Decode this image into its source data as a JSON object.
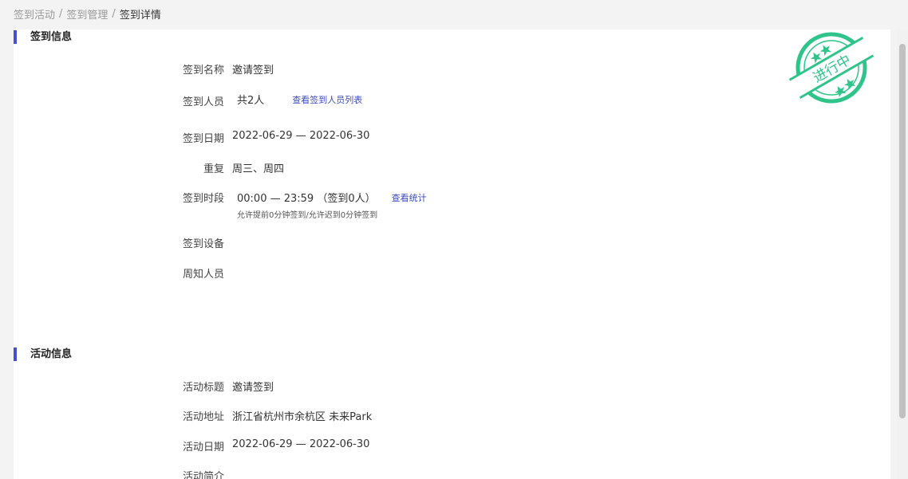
{
  "breadcrumb": {
    "items": [
      "签到活动",
      "签到管理"
    ],
    "separator": "/",
    "current": "签到详情"
  },
  "checkin_section": {
    "title": "签到信息",
    "name_label": "签到名称",
    "name_value": "邀请签到",
    "people_label": "签到人员",
    "people_value": "共2人",
    "people_link": "查看签到人员列表",
    "date_label": "签到日期",
    "date_value": "2022-06-29 — 2022-06-30",
    "repeat_label": "重复",
    "repeat_value": "周三、周四",
    "period_label": "签到时段",
    "period_value": "00:00 — 23:59 （签到0人）",
    "period_link": "查看统计",
    "period_hint": "允许提前0分钟签到/允许迟到0分钟签到",
    "device_label": "签到设备",
    "notify_label": "周知人员"
  },
  "activity_section": {
    "title": "活动信息",
    "title_label": "活动标题",
    "title_value": "邀请签到",
    "address_label": "活动地址",
    "address_value": "浙江省杭州市余杭区 未来Park",
    "date_label": "活动日期",
    "date_value": "2022-06-29 — 2022-06-30",
    "intro_label": "活动简介"
  },
  "stamp": {
    "text": "进行中",
    "color": "#2fc48a",
    "icon": "status-stamp-icon"
  },
  "colors": {
    "accent": "#4452c8",
    "link": "#3d4bbf"
  }
}
